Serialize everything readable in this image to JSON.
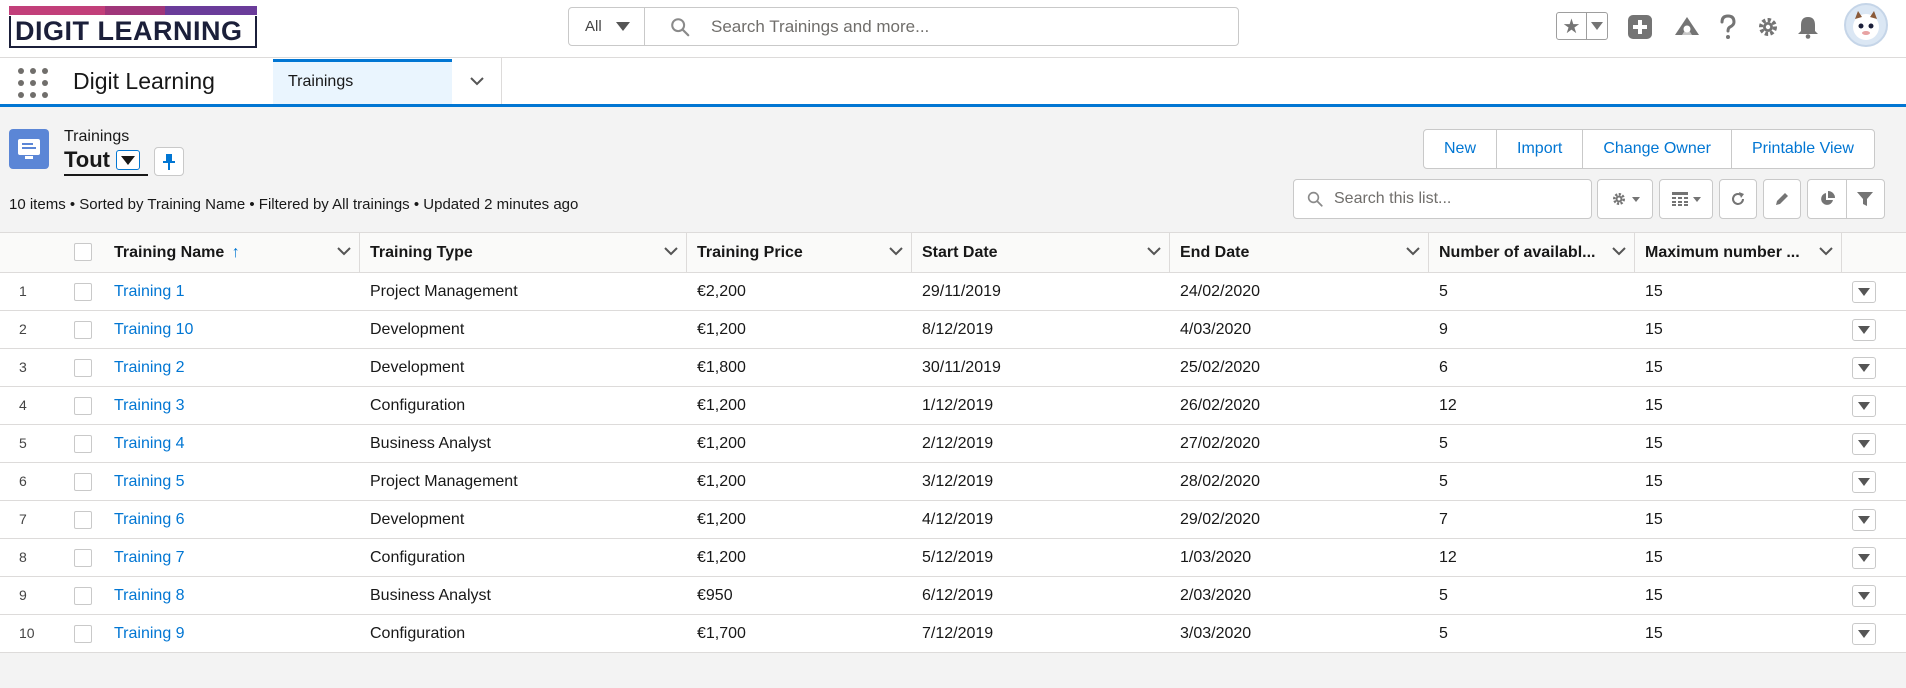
{
  "brand": {
    "logo_text": "DIGIT LEARNING",
    "colors": {
      "bar1": "#c23f7a",
      "bar2": "#8c2e6e",
      "bar3": "#6a3c9a",
      "primary": "#0176d3"
    }
  },
  "search": {
    "scope": "All",
    "placeholder": "Search Trainings and more..."
  },
  "nav": {
    "app_name": "Digit Learning",
    "tab_label": "Trainings"
  },
  "list": {
    "object_label": "Trainings",
    "view_name": "Tout",
    "summary": "10 items • Sorted by Training Name • Filtered by All trainings • Updated 2 minutes ago",
    "search_placeholder": "Search this list...",
    "actions": [
      "New",
      "Import",
      "Change Owner",
      "Printable View"
    ]
  },
  "table": {
    "columns": [
      "Training Name",
      "Training Type",
      "Training Price",
      "Start Date",
      "End Date",
      "Number of availabl...",
      "Maximum number ..."
    ],
    "sort_indicator": "↑",
    "rows": [
      {
        "n": "1",
        "name": "Training 1",
        "type": "Project Management",
        "price": "€2,200",
        "start": "29/11/2019",
        "end": "24/02/2020",
        "avail": "5",
        "max": "15"
      },
      {
        "n": "2",
        "name": "Training 10",
        "type": "Development",
        "price": "€1,200",
        "start": "8/12/2019",
        "end": "4/03/2020",
        "avail": "9",
        "max": "15"
      },
      {
        "n": "3",
        "name": "Training 2",
        "type": "Development",
        "price": "€1,800",
        "start": "30/11/2019",
        "end": "25/02/2020",
        "avail": "6",
        "max": "15"
      },
      {
        "n": "4",
        "name": "Training 3",
        "type": "Configuration",
        "price": "€1,200",
        "start": "1/12/2019",
        "end": "26/02/2020",
        "avail": "12",
        "max": "15"
      },
      {
        "n": "5",
        "name": "Training 4",
        "type": "Business Analyst",
        "price": "€1,200",
        "start": "2/12/2019",
        "end": "27/02/2020",
        "avail": "5",
        "max": "15"
      },
      {
        "n": "6",
        "name": "Training 5",
        "type": "Project Management",
        "price": "€1,200",
        "start": "3/12/2019",
        "end": "28/02/2020",
        "avail": "5",
        "max": "15"
      },
      {
        "n": "7",
        "name": "Training 6",
        "type": "Development",
        "price": "€1,200",
        "start": "4/12/2019",
        "end": "29/02/2020",
        "avail": "7",
        "max": "15"
      },
      {
        "n": "8",
        "name": "Training 7",
        "type": "Configuration",
        "price": "€1,200",
        "start": "5/12/2019",
        "end": "1/03/2020",
        "avail": "12",
        "max": "15"
      },
      {
        "n": "9",
        "name": "Training 8",
        "type": "Business Analyst",
        "price": "€950",
        "start": "6/12/2019",
        "end": "2/03/2020",
        "avail": "5",
        "max": "15"
      },
      {
        "n": "10",
        "name": "Training 9",
        "type": "Configuration",
        "price": "€1,700",
        "start": "7/12/2019",
        "end": "3/03/2020",
        "avail": "5",
        "max": "15"
      }
    ]
  }
}
